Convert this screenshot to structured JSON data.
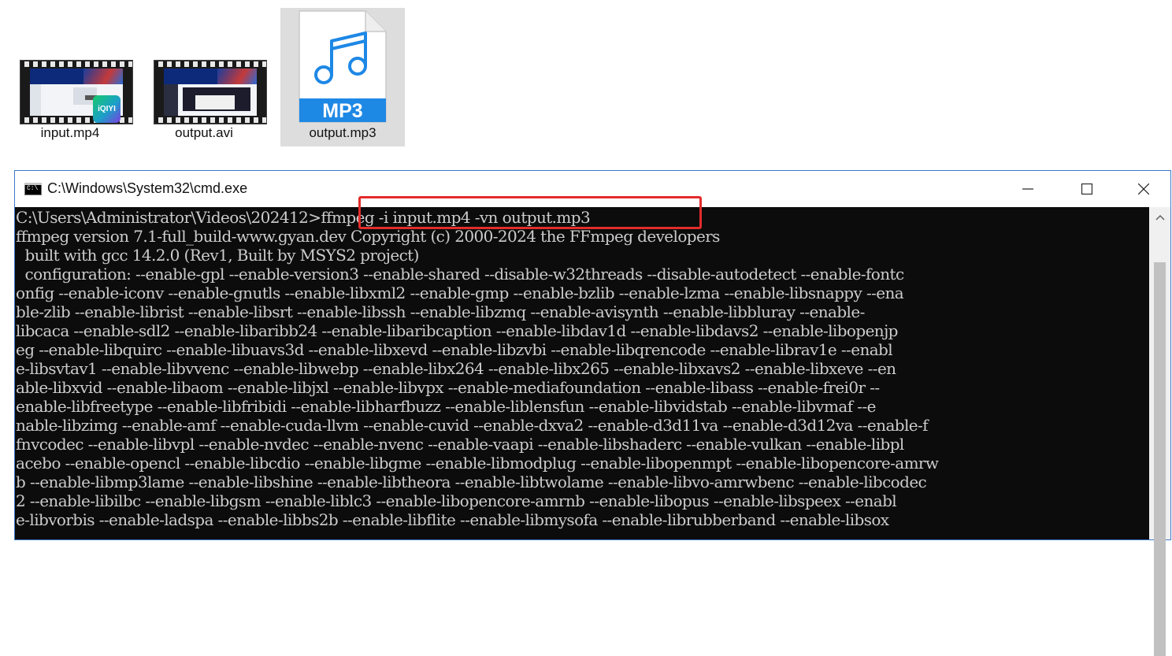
{
  "files": [
    {
      "name": "input.mp4",
      "type": "video",
      "badge": "iQIYI"
    },
    {
      "name": "output.avi",
      "type": "video"
    },
    {
      "name": "output.mp3",
      "type": "audio",
      "badge": "MP3",
      "selected": true
    }
  ],
  "window": {
    "title": "C:\\Windows\\System32\\cmd.exe",
    "app_icon_text": "C:\\",
    "controls": [
      "minimize-icon",
      "maximize-icon",
      "close-icon"
    ]
  },
  "console": {
    "lines": [
      "C:\\Users\\Administrator\\Videos\\202412>ffmpeg -i input.mp4 -vn output.mp3",
      "ffmpeg version 7.1-full_build-www.gyan.dev Copyright (c) 2000-2024 the FFmpeg developers",
      "  built with gcc 14.2.0 (Rev1, Built by MSYS2 project)",
      "  configuration: --enable-gpl --enable-version3 --enable-shared --disable-w32threads --disable-autodetect --enable-fontc",
      "onfig --enable-iconv --enable-gnutls --enable-libxml2 --enable-gmp --enable-bzlib --enable-lzma --enable-libsnappy --ena",
      "ble-zlib --enable-librist --enable-libsrt --enable-libssh --enable-libzmq --enable-avisynth --enable-libbluray --enable-",
      "libcaca --enable-sdl2 --enable-libaribb24 --enable-libaribcaption --enable-libdav1d --enable-libdavs2 --enable-libopenjp",
      "eg --enable-libquirc --enable-libuavs3d --enable-libxevd --enable-libzvbi --enable-libqrencode --enable-librav1e --enabl",
      "e-libsvtav1 --enable-libvvenc --enable-libwebp --enable-libx264 --enable-libx265 --enable-libxavs2 --enable-libxeve --en",
      "able-libxvid --enable-libaom --enable-libjxl --enable-libvpx --enable-mediafoundation --enable-libass --enable-frei0r --",
      "enable-libfreetype --enable-libfribidi --enable-libharfbuzz --enable-liblensfun --enable-libvidstab --enable-libvmaf --e",
      "nable-libzimg --enable-amf --enable-cuda-llvm --enable-cuvid --enable-dxva2 --enable-d3d11va --enable-d3d12va --enable-f",
      "fnvcodec --enable-libvpl --enable-nvdec --enable-nvenc --enable-vaapi --enable-libshaderc --enable-vulkan --enable-libpl",
      "acebo --enable-opencl --enable-libcdio --enable-libgme --enable-libmodplug --enable-libopenmpt --enable-libopencore-amrw",
      "b --enable-libmp3lame --enable-libshine --enable-libtheora --enable-libtwolame --enable-libvo-amrwbenc --enable-libcodec",
      "2 --enable-libilbc --enable-libgsm --enable-liblc3 --enable-libopencore-amrnb --enable-libopus --enable-libspeex --enabl",
      "e-libvorbis --enable-ladspa --enable-libbs2b --enable-libflite --enable-libmysofa --enable-librubberband --enable-libsox"
    ]
  },
  "colors": {
    "console_bg": "#0c0c0c",
    "console_text": "#cccccc",
    "highlight_border": "#e32b2b",
    "window_border": "#3c7ac6",
    "mp3_blue": "#1e88e5"
  }
}
